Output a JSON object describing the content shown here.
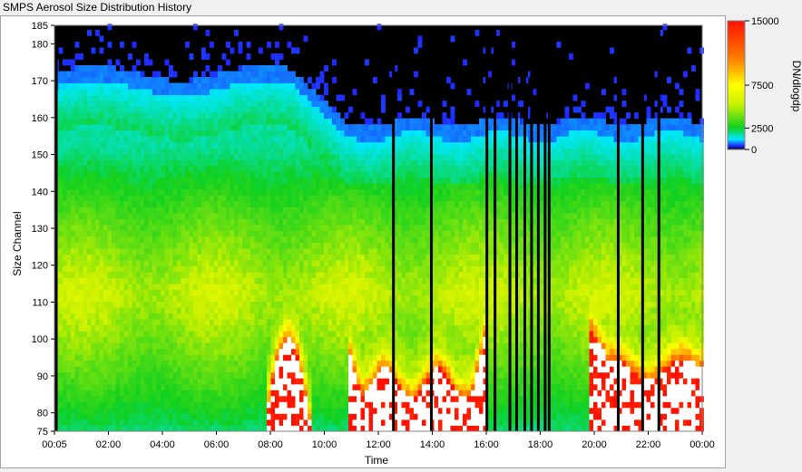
{
  "window": {
    "title": "SMPS Aerosol Size Distribution History"
  },
  "chart_data": {
    "type": "heatmap",
    "title": "",
    "xlabel": "Time",
    "ylabel": "Size Channel",
    "x_ticks": [
      "00:05",
      "02:00",
      "04:00",
      "06:00",
      "08:00",
      "10:00",
      "12:00",
      "14:00",
      "16:00",
      "18:00",
      "20:00",
      "22:00",
      "00:00"
    ],
    "x_range_hours": [
      0.083,
      24.0
    ],
    "y_ticks": [
      75,
      80,
      90,
      100,
      110,
      120,
      130,
      140,
      150,
      160,
      170,
      180,
      185
    ],
    "ylim": [
      75,
      185
    ],
    "colorbar": {
      "label": "DN/dlogdp",
      "ticks": [
        0,
        2500,
        7500,
        15000
      ],
      "range": [
        0,
        15000
      ],
      "colors": [
        "#000000",
        "#2020ff",
        "#00e8ff",
        "#10d020",
        "#c8f000",
        "#ffff00",
        "#ff8000",
        "#ff1000",
        "#ffffff"
      ]
    },
    "dropout_times_hours": [
      0.15,
      12.6,
      14.0,
      16.05,
      16.35,
      16.9,
      17.15,
      17.45,
      17.7,
      17.95,
      18.2,
      18.35,
      20.9,
      21.8,
      22.4
    ],
    "notes": "Background concentration field: highest (2500-7500) at channels 95-140, falling to 0 above channel ~160-170; saturated (>15000, white) plumes near channels 75-100 around 08:00-10:00, 11:00-16:00 and 20:00-24:00"
  }
}
